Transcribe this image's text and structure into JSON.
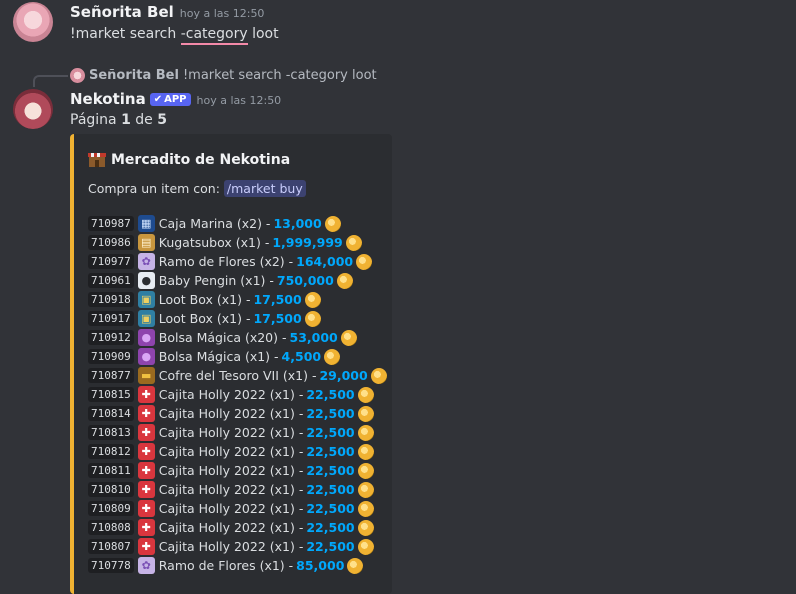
{
  "msg1": {
    "author": "Señorita Bel",
    "time": "hoy a las 12:50",
    "text_before": "!market search ",
    "text_underlined": "-category",
    "text_after": " loot"
  },
  "reply": {
    "author": "Señorita Bel",
    "text": "!market search -category loot"
  },
  "msg2": {
    "author": "Nekotina",
    "badge": "APP",
    "time": "hoy a las 12:50",
    "page_prefix": "Página ",
    "page_current": "1",
    "page_mid": " de ",
    "page_total": "5"
  },
  "embed": {
    "accent_color": "#f0b232",
    "title": "Mercadito de Nekotina",
    "desc_prefix": "Compra un item con: ",
    "desc_command": "/market buy",
    "items": [
      {
        "id": "710987",
        "icon": "ocean-box-icon",
        "name": "Caja Marina (x2) - ",
        "price": "13,000"
      },
      {
        "id": "710986",
        "icon": "kugatsu-box-icon",
        "name": "Kugatsubox (x1) - ",
        "price": "1,999,999"
      },
      {
        "id": "710977",
        "icon": "flower-bouquet-icon",
        "name": "Ramo de Flores (x2) - ",
        "price": "164,000"
      },
      {
        "id": "710961",
        "icon": "penguin-icon",
        "name": "Baby Pengin (x1) - ",
        "price": "750,000"
      },
      {
        "id": "710918",
        "icon": "loot-box-icon",
        "name": "Loot Box (x1) - ",
        "price": "17,500"
      },
      {
        "id": "710917",
        "icon": "loot-box-icon",
        "name": "Loot Box (x1) - ",
        "price": "17,500"
      },
      {
        "id": "710912",
        "icon": "magic-bag-icon",
        "name": "Bolsa Mágica (x20) - ",
        "price": "53,000"
      },
      {
        "id": "710909",
        "icon": "magic-bag-icon",
        "name": "Bolsa Mágica (x1) - ",
        "price": "4,500"
      },
      {
        "id": "710877",
        "icon": "treasure-chest-icon",
        "name": "Cofre del Tesoro VII (x1) - ",
        "price": "29,000"
      },
      {
        "id": "710815",
        "icon": "gift-icon",
        "name": "Cajita Holly 2022 (x1) - ",
        "price": "22,500"
      },
      {
        "id": "710814",
        "icon": "gift-icon",
        "name": "Cajita Holly 2022 (x1) - ",
        "price": "22,500"
      },
      {
        "id": "710813",
        "icon": "gift-icon",
        "name": "Cajita Holly 2022 (x1) - ",
        "price": "22,500"
      },
      {
        "id": "710812",
        "icon": "gift-icon",
        "name": "Cajita Holly 2022 (x1) - ",
        "price": "22,500"
      },
      {
        "id": "710811",
        "icon": "gift-icon",
        "name": "Cajita Holly 2022 (x1) - ",
        "price": "22,500"
      },
      {
        "id": "710810",
        "icon": "gift-icon",
        "name": "Cajita Holly 2022 (x1) - ",
        "price": "22,500"
      },
      {
        "id": "710809",
        "icon": "gift-icon",
        "name": "Cajita Holly 2022 (x1) - ",
        "price": "22,500"
      },
      {
        "id": "710808",
        "icon": "gift-icon",
        "name": "Cajita Holly 2022 (x1) - ",
        "price": "22,500"
      },
      {
        "id": "710807",
        "icon": "gift-icon",
        "name": "Cajita Holly 2022 (x1) - ",
        "price": "22,500"
      },
      {
        "id": "710778",
        "icon": "flower-bouquet-icon",
        "name": "Ramo de Flores (x1) - ",
        "price": "85,000"
      }
    ]
  }
}
